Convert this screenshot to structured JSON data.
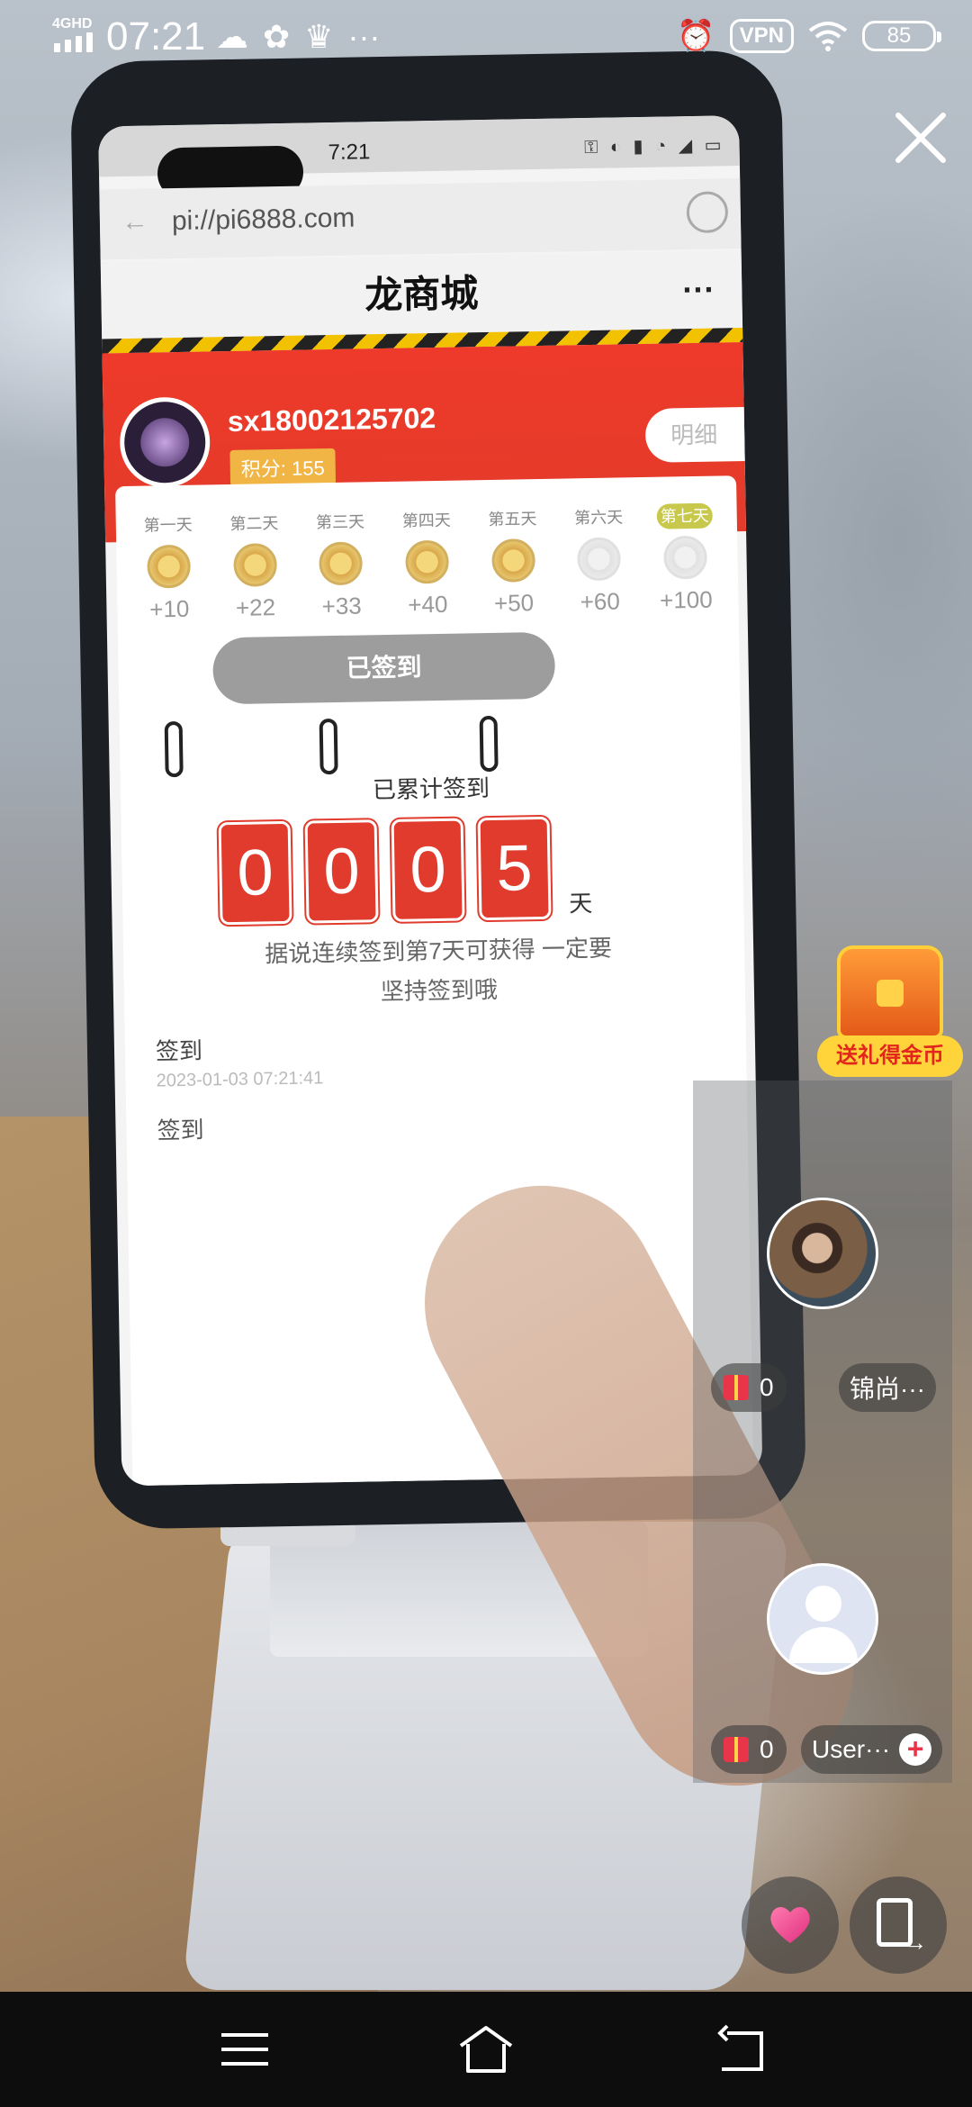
{
  "status_bar": {
    "network": "4GHD",
    "time": "07:21",
    "icons": [
      "cloud-icon",
      "fan-icon",
      "crown-icon",
      "more-dots-icon"
    ],
    "right_icons": [
      "alarm-icon",
      "wifi-icon"
    ],
    "vpn_label": "VPN",
    "battery": "85"
  },
  "video": {
    "phone_screen": {
      "status_time": "7:21",
      "url": "pi://pi6888.com",
      "page_title": "龙商城",
      "more": "···",
      "username": "sx18002125702",
      "score_label": "积分: 155",
      "detail_button": "明细",
      "days": [
        {
          "label": "第一天",
          "points": "+10",
          "done": true
        },
        {
          "label": "第二天",
          "points": "+22",
          "done": true
        },
        {
          "label": "第三天",
          "points": "+33",
          "done": true
        },
        {
          "label": "第四天",
          "points": "+40",
          "done": true
        },
        {
          "label": "第五天",
          "points": "+50",
          "done": true
        },
        {
          "label": "第六天",
          "points": "+60",
          "done": false
        },
        {
          "label": "第七天",
          "points": "+100",
          "done": false
        }
      ],
      "signed_button": "已签到",
      "accumulated_label": "已累计签到",
      "digits": [
        "0",
        "0",
        "0",
        "5"
      ],
      "day_unit": "天",
      "note_line1": "据说连续签到第7天可获得 一定要",
      "note_line2": "坚持签到哦",
      "record_label": "签到",
      "record_date": "2023-01-03 07:21:41",
      "record_label2": "签到"
    }
  },
  "overlay": {
    "treasure_label": "送礼得金币",
    "guests": [
      {
        "gift_count": "0",
        "name": "锦尚···",
        "avatar": "photo"
      },
      {
        "gift_count": "0",
        "name": "User···",
        "avatar": "default"
      }
    ],
    "plus_label": "+"
  },
  "nav": {
    "buttons": [
      "menu-icon",
      "home-icon",
      "back-icon"
    ]
  }
}
